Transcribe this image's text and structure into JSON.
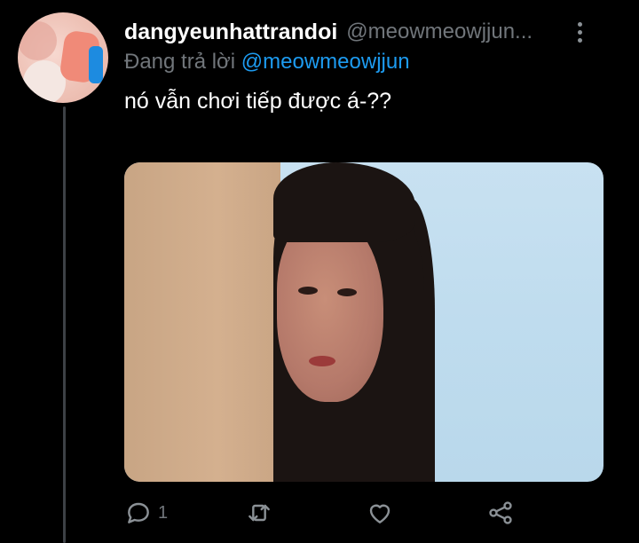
{
  "tweet": {
    "display_name": "dangyeunhattrandoi",
    "handle": "@meowmeowjjun...",
    "reply_prefix": "Đang trả lời",
    "reply_mention": "@meowmeowjjun",
    "text": "nó vẫn chơi tiếp được á-??",
    "actions": {
      "reply_count": "1",
      "retweet_count": "",
      "like_count": ""
    }
  },
  "icons": {
    "more": "more-vertical-icon",
    "reply": "reply-bubble-icon",
    "retweet": "retweet-icon",
    "like": "heart-icon",
    "share": "share-icon"
  },
  "colors": {
    "background": "#000000",
    "secondary_text": "#71767b",
    "mention": "#1d9bf0"
  }
}
